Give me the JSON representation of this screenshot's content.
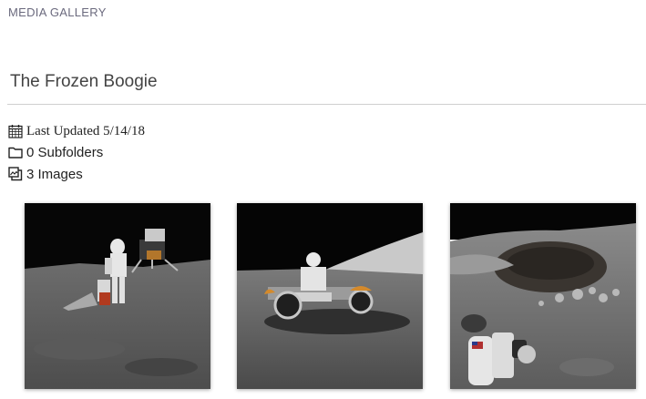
{
  "header": {
    "section_label": "MEDIA GALLERY"
  },
  "gallery": {
    "title": "The Frozen Boogie",
    "last_updated": "Last Updated 5/14/18",
    "subfolders": "0 Subfolders",
    "images": "3 Images"
  },
  "icons": {
    "updated": "calendar-icon",
    "subfolders": "folder-icon",
    "images": "images-icon"
  },
  "thumbnails": [
    {
      "name": "astronaut-with-lunar-module"
    },
    {
      "name": "astronaut-on-lunar-rover"
    },
    {
      "name": "lunar-crater-with-rocks"
    }
  ]
}
